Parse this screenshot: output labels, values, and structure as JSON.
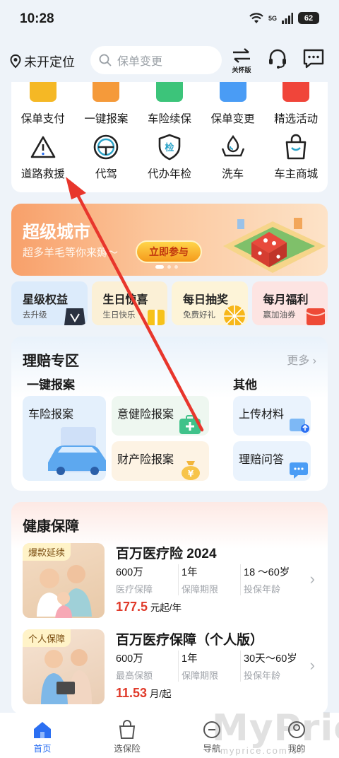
{
  "status": {
    "time": "10:28",
    "battery": "62",
    "network": "5G"
  },
  "top_bar": {
    "location": "未开定位",
    "search_placeholder": "保单变更",
    "care_mode_label": "关怀版"
  },
  "services": {
    "row1": [
      {
        "label": "保单支付",
        "color": "#f5b825"
      },
      {
        "label": "一键报案",
        "color": "#f59a3a"
      },
      {
        "label": "车险续保",
        "color": "#3cc47a"
      },
      {
        "label": "保单变更",
        "color": "#4a9cf5"
      },
      {
        "label": "精选活动",
        "color": "#f0453a"
      }
    ],
    "row2": [
      {
        "label": "道路救援",
        "icon": "warning-icon"
      },
      {
        "label": "代驾",
        "icon": "steering-wheel-icon"
      },
      {
        "label": "代办年检",
        "icon": "inspection-shield-icon",
        "icon_text": "检"
      },
      {
        "label": "洗车",
        "icon": "car-wash-icon"
      },
      {
        "label": "车主商城",
        "icon": "shopping-bag-icon"
      }
    ]
  },
  "banner": {
    "title": "超级城市",
    "subtitle": "超多羊毛等你来薅～",
    "button": "立即参与"
  },
  "benefits": [
    {
      "title": "星级权益",
      "subtitle": "去升级",
      "bg": "#dcebfb"
    },
    {
      "title": "生日惊喜",
      "subtitle": "生日快乐",
      "bg": "#fbf0d6"
    },
    {
      "title": "每日抽奖",
      "subtitle": "免费好礼",
      "bg": "#fdf4d8"
    },
    {
      "title": "每月福利",
      "subtitle": "赢加油券",
      "bg": "#fde4e2"
    }
  ],
  "claims": {
    "title": "理赔专区",
    "more": "更多",
    "report_heading": "一键报案",
    "other_heading": "其他",
    "auto_claim": "车险报案",
    "accident_health_claim": "意健险报案",
    "property_claim": "财产险报案",
    "upload_docs": "上传材料",
    "claim_qa": "理赔问答"
  },
  "health": {
    "title": "健康保障",
    "products": [
      {
        "tag": "爆款延续",
        "name": "百万医疗险 2024",
        "stats": [
          {
            "value": "600万",
            "label": "医疗保障"
          },
          {
            "value": "1年",
            "label": "保障期限"
          },
          {
            "value": "18 ～60岁",
            "label": "投保年龄"
          }
        ],
        "price": "177.5",
        "unit": "元起/年"
      },
      {
        "tag": "个人保障",
        "name": "百万医疗保障（个人版）",
        "stats": [
          {
            "value": "600万",
            "label": "最高保额"
          },
          {
            "value": "1年",
            "label": "保障期限"
          },
          {
            "value": "30天～60岁",
            "label": "投保年龄"
          }
        ],
        "price": "11.53",
        "unit": "月/起"
      }
    ]
  },
  "nav": [
    {
      "label": "首页",
      "icon": "home-icon",
      "active": true
    },
    {
      "label": "选保险",
      "icon": "shopping-bag-icon",
      "active": false
    },
    {
      "label": "导航",
      "icon": "compass-icon",
      "active": false
    },
    {
      "label": "我的",
      "icon": "profile-icon",
      "active": false
    }
  ],
  "watermark": {
    "text": "MyPrice",
    "sub": "myprice.com.cn"
  },
  "colors": {
    "accent": "#2b6ff2",
    "price": "#e03a2a",
    "annotation_arrow": "#e8362c"
  }
}
